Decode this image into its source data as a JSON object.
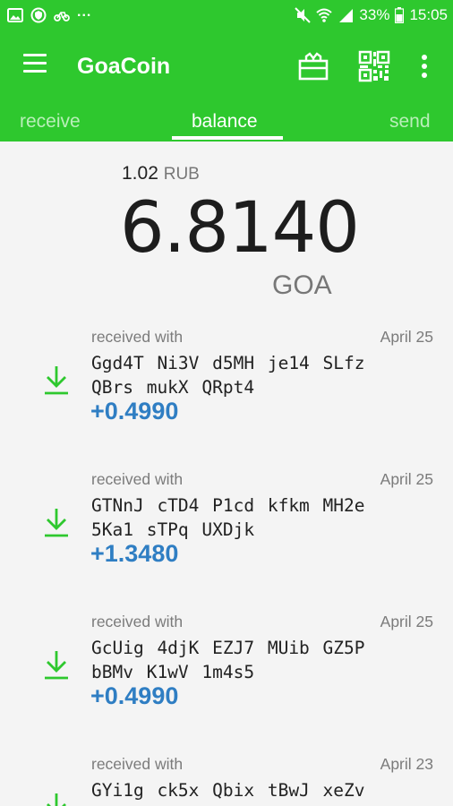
{
  "status_bar": {
    "more": "...",
    "battery": "33%",
    "time": "15:05"
  },
  "toolbar": {
    "title": "GoaCoin",
    "icons": [
      "menu-icon",
      "gift-icon",
      "qr-code-icon",
      "overflow-menu-icon"
    ]
  },
  "tabs": [
    "receive",
    "balance",
    "send"
  ],
  "active_tab": "balance",
  "balance": {
    "local_value": "1.02",
    "local_currency": "RUB",
    "amount": "6.8140",
    "unit": "GOA"
  },
  "transactions": [
    {
      "type": "received with",
      "date": "April 25",
      "address": "Ggd4T Ni3V d5MH je14 SLfz\nQBrs mukX QRpt4",
      "amount": "+0.4990"
    },
    {
      "type": "received with",
      "date": "April 25",
      "address": "GTNnJ cTD4 P1cd kfkm MH2e\n5Ka1 sTPq UXDjk",
      "amount": "+1.3480"
    },
    {
      "type": "received with",
      "date": "April 25",
      "address": "GcUig 4djK EZJ7 MUib GZ5P\nbBMv K1wV 1m4s5",
      "amount": "+0.4990"
    },
    {
      "type": "received with",
      "date": "April 23",
      "address": "GYi1g ck5x Qbix tBwJ xeZv",
      "amount": ""
    }
  ],
  "colors": {
    "primary": "#2ec82e",
    "amount": "#2f7ec3",
    "icon": "#2ec82e"
  }
}
